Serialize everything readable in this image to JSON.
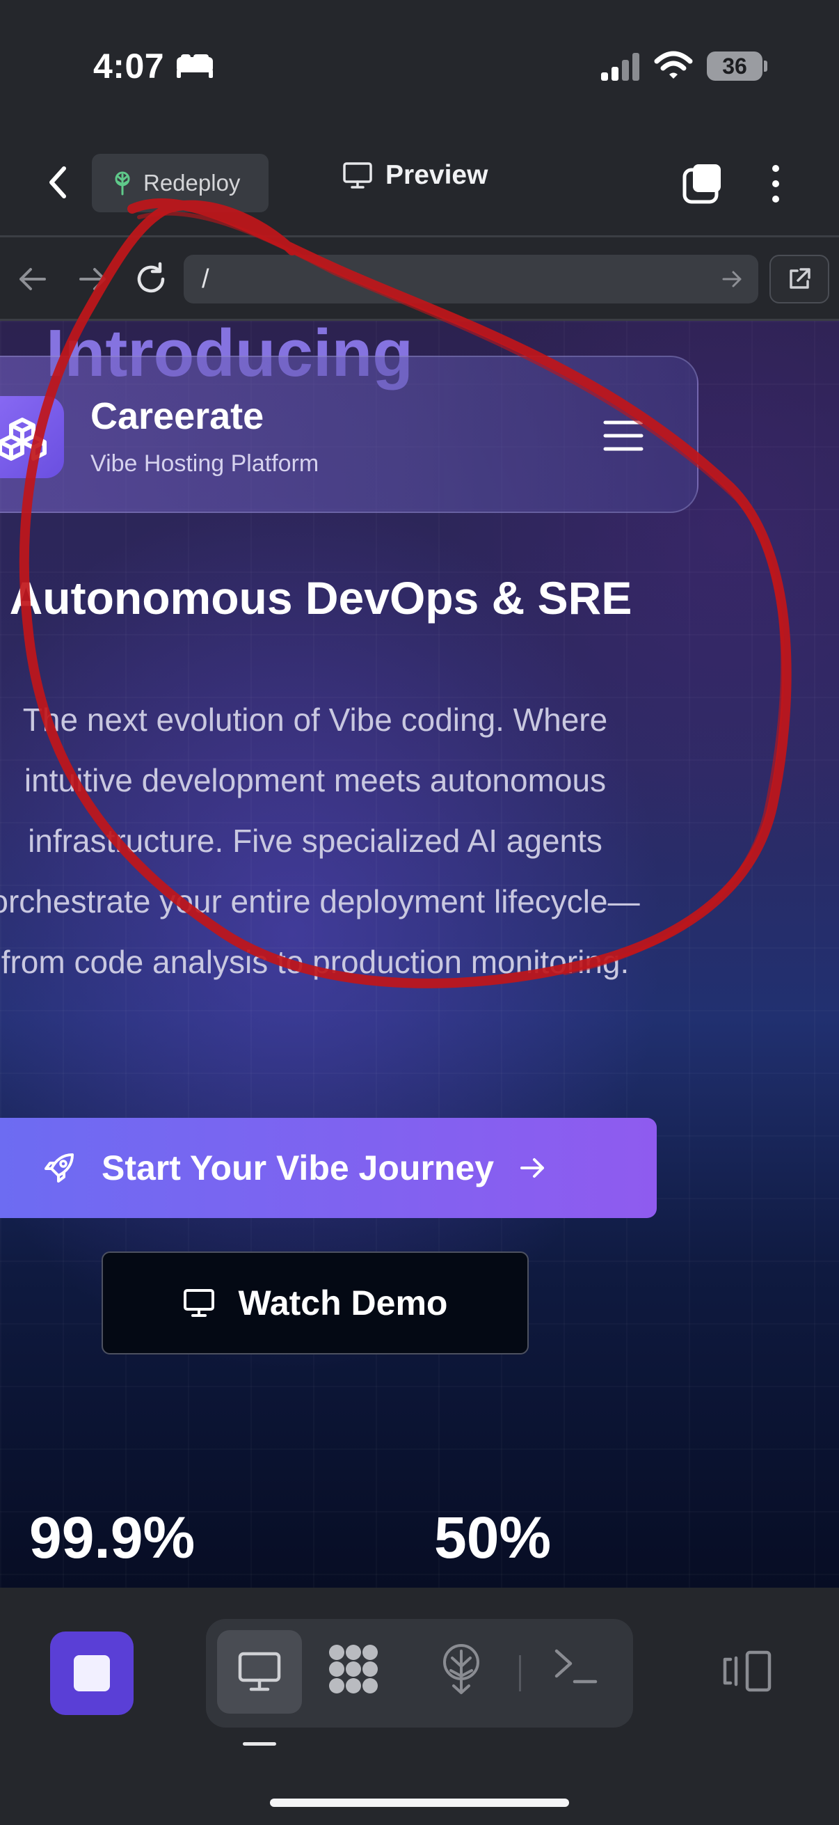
{
  "status_bar": {
    "time": "4:07",
    "battery": "36"
  },
  "header": {
    "redeploy_label": "Redeploy",
    "preview_label": "Preview"
  },
  "url_bar": {
    "path": "/"
  },
  "site": {
    "behind_heading": "Introducing",
    "brand_name": "Careerate",
    "brand_tagline": "Vibe Hosting Platform",
    "hero_title": "Autonomous DevOps & SRE",
    "hero_description": "The next evolution of Vibe coding. Where intuitive development meets autonomous infrastructure. Five specialized AI agents orchestrate your entire deployment lifecycle—from code analysis to production monitoring.",
    "cta_label": "Start Your Vibe Journey",
    "demo_label": "Watch Demo",
    "stats": [
      "99.9%",
      "50%"
    ]
  },
  "annotation": {
    "color": "#c0161a",
    "shape": "hand-drawn-circle"
  },
  "colors": {
    "accent": "#8f5bef",
    "stop_button": "#5a3fd6",
    "chrome_bg": "#25272c"
  },
  "toolbar_icons": [
    "stop-icon",
    "monitor-icon",
    "apps-icon",
    "deploy-icon",
    "terminal-icon",
    "panel-icon"
  ]
}
